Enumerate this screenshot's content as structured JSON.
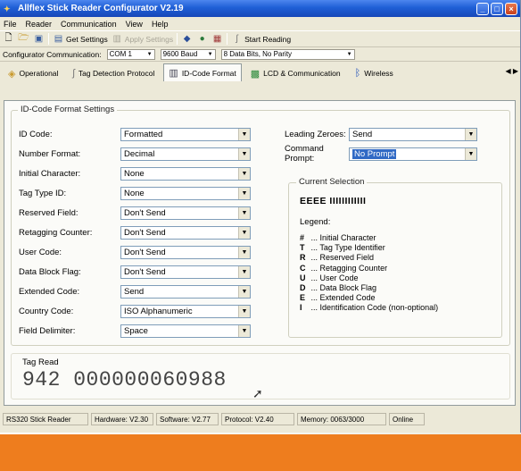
{
  "window": {
    "title": "Allflex Stick Reader Configurator V2.19",
    "min": "_",
    "max": "□",
    "close": "×"
  },
  "menu": [
    "File",
    "Reader",
    "Communication",
    "View",
    "Help"
  ],
  "toolbar": {
    "get_settings": "Get Settings",
    "apply_settings": "Apply Settings",
    "start_reading": "Start Reading"
  },
  "comm": {
    "label": "Configurator Communication:",
    "port": "COM 1",
    "baud": "9600 Baud",
    "format": "8 Data Bits, No Parity"
  },
  "tabs": [
    "Operational",
    "Tag Detection Protocol",
    "ID-Code Format",
    "LCD & Communication",
    "Wireless"
  ],
  "group_title": "ID-Code Format Settings",
  "fields": [
    {
      "label": "ID Code:",
      "value": "Formatted"
    },
    {
      "label": "Number Format:",
      "value": "Decimal"
    },
    {
      "label": "Initial Character:",
      "value": "None"
    },
    {
      "label": "Tag Type ID:",
      "value": "None"
    },
    {
      "label": "Reserved Field:",
      "value": "Don't Send"
    },
    {
      "label": "Retagging Counter:",
      "value": "Don't Send"
    },
    {
      "label": "User Code:",
      "value": "Don't Send"
    },
    {
      "label": "Data Block Flag:",
      "value": "Don't Send"
    },
    {
      "label": "Extended Code:",
      "value": "Send"
    },
    {
      "label": "Country Code:",
      "value": "ISO Alphanumeric"
    },
    {
      "label": "Field Delimiter:",
      "value": "Space"
    }
  ],
  "right_fields": {
    "leading_zeroes_label": "Leading Zeroes:",
    "leading_zeroes_value": "Send",
    "command_prompt_label": "Command Prompt:",
    "command_prompt_value": "No Prompt"
  },
  "current_selection": {
    "title": "Current Selection",
    "code": "EEEE IIIIIIIIIIII",
    "legend_label": "Legend:",
    "legend": [
      {
        "key": "#",
        "text": "... Initial Character"
      },
      {
        "key": "T",
        "text": "... Tag Type Identifier"
      },
      {
        "key": "R",
        "text": "... Reserved Field"
      },
      {
        "key": "C",
        "text": "... Retagging Counter"
      },
      {
        "key": "U",
        "text": "... User Code"
      },
      {
        "key": "D",
        "text": "... Data Block Flag"
      },
      {
        "key": "E",
        "text": "... Extended Code"
      },
      {
        "key": "I",
        "text": "... Identification Code (non-optional)"
      }
    ]
  },
  "tag_read": {
    "label": "Tag Read",
    "value": "942 000000060988"
  },
  "status": [
    "RS320 Stick Reader",
    "Hardware: V2.30",
    "Software: V2.77",
    "Protocol: V2.40",
    "Memory: 0063/3000",
    "Online"
  ],
  "colors": {
    "titlebar": "#1f5fd6",
    "selection": "#316ac5",
    "band": "#ee7d1e"
  }
}
